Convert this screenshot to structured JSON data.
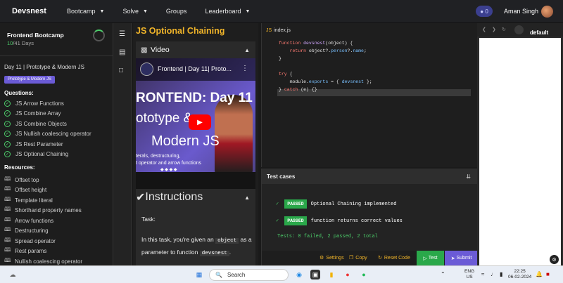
{
  "topnav": {
    "brand": "Devsnest",
    "links": [
      {
        "label": "Bootcamp",
        "has_dropdown": true
      },
      {
        "label": "Solve",
        "has_dropdown": true
      },
      {
        "label": "Groups",
        "has_dropdown": false
      },
      {
        "label": "Leaderboard",
        "has_dropdown": true
      }
    ],
    "coins": "0",
    "user_name": "Aman Singh"
  },
  "sidebar": {
    "course_title": "Frontend Bootcamp",
    "days_done": "10",
    "days_total": "/41 Days",
    "day_title": "Day 11 | Prototype & Modern JS",
    "tag": "Prototype & Modern JS",
    "questions_heading": "Questions:",
    "questions": [
      "JS Arrow Functions",
      "JS Combine Array",
      "JS Combine Objects",
      "JS Nullish coalescing operator",
      "JS Rest Parameter",
      "JS Optional Chaining"
    ],
    "resources_heading": "Resources:",
    "resources": [
      "Offset top",
      "Offset height",
      "Template literal",
      "Shorthand property names",
      "Arrow functions",
      "Destructuring",
      "Spread operator",
      "Rest params",
      "Nullish coalescing operator"
    ]
  },
  "problem": {
    "title": "JS Optional Chaining",
    "video_label": "Video",
    "video_title": "Frontend | Day 11| Proto...",
    "thumb_line1": "RONTEND: Day 11",
    "thumb_line2": "ototype &",
    "thumb_line3": "Modern JS",
    "thumb_line4": "terals, destructuring,",
    "thumb_line5": "t operator and arrow functions",
    "instructions_label": "Instructions",
    "task_label": "Task:",
    "para_1": "In this task, you're given an",
    "code_1": "object",
    "para_2": "as a parameter to function",
    "code_2": "devsnest",
    "para_3": "."
  },
  "editor": {
    "file_name": "index.js",
    "lines": [
      {
        "n": "1",
        "parts": [
          [
            "k",
            "function "
          ],
          [
            "f",
            "devsnest"
          ],
          [
            "t",
            "(object) {"
          ]
        ]
      },
      {
        "n": "2",
        "parts": [
          [
            "k",
            "    return "
          ],
          [
            "t",
            "object?."
          ],
          [
            "v",
            "person"
          ],
          [
            "t",
            "?."
          ],
          [
            "v",
            "name"
          ],
          [
            "t",
            ";"
          ]
        ]
      },
      {
        "n": "3",
        "parts": [
          [
            "t",
            "}"
          ]
        ]
      },
      {
        "n": "4",
        "parts": []
      },
      {
        "n": "5",
        "parts": [
          [
            "k",
            "try "
          ],
          [
            "t",
            "{"
          ]
        ]
      },
      {
        "n": "6",
        "parts": [
          [
            "t",
            "    module."
          ],
          [
            "v",
            "exports"
          ],
          [
            "t",
            " = { "
          ],
          [
            "v",
            "devsnest"
          ],
          [
            "t",
            " };"
          ]
        ]
      },
      {
        "n": "7",
        "parts": [
          [
            "t",
            "} "
          ],
          [
            "k",
            "catch "
          ],
          [
            "t",
            "(e) {}"
          ]
        ]
      },
      {
        "n": "8",
        "parts": []
      }
    ]
  },
  "tests": {
    "heading": "Test cases",
    "results": [
      {
        "status": "PASSED",
        "name": "Optional Chaining implemented"
      },
      {
        "status": "PASSED",
        "name": "function returns correct values"
      }
    ],
    "summary": "Tests: 0 failed, 2 passed, 2 total"
  },
  "actions": {
    "settings": "Settings",
    "copy": "Copy",
    "reset": "Reset Code",
    "test": "Test",
    "submit": "Submit"
  },
  "preview": {
    "theme": "default"
  },
  "taskbar": {
    "search_label": "Search",
    "lang_1": "ENG",
    "lang_2": "US",
    "time": "22:25",
    "date": "06-02-2024"
  },
  "colors": {
    "accent_yellow": "#f0b429",
    "pass_green": "#2aa84a",
    "purple": "#6b5bd6"
  }
}
